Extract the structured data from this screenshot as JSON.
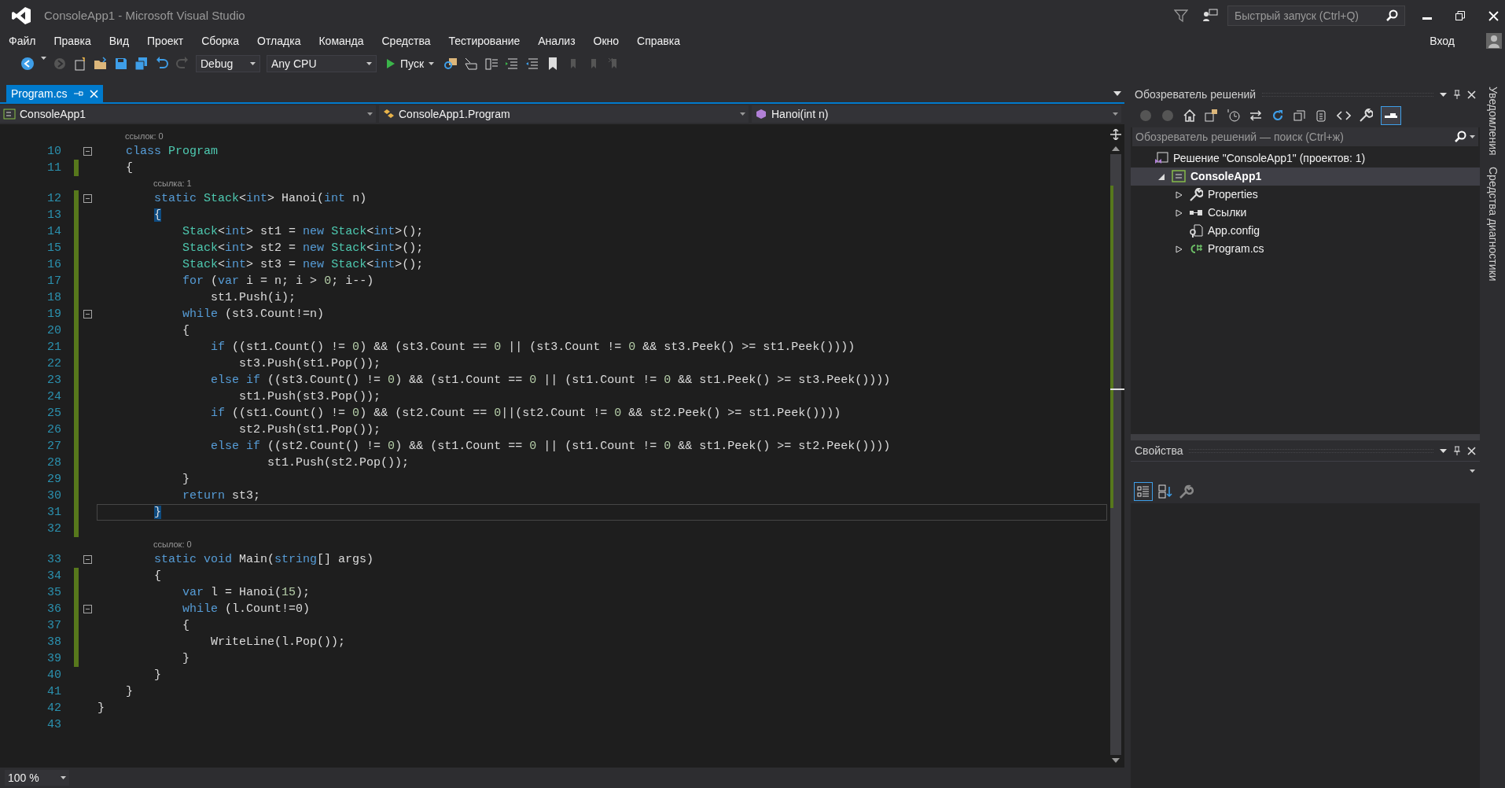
{
  "window": {
    "title": "ConsoleApp1 - Microsoft Visual Studio"
  },
  "quick_launch": {
    "placeholder": "Быстрый запуск (Ctrl+Q)"
  },
  "sign_in": "Вход",
  "menu": [
    "Файл",
    "Правка",
    "Вид",
    "Проект",
    "Сборка",
    "Отладка",
    "Команда",
    "Средства",
    "Тестирование",
    "Анализ",
    "Окно",
    "Справка"
  ],
  "toolbar": {
    "configuration": "Debug",
    "platform": "Any CPU",
    "start": "Пуск"
  },
  "document_tabs": [
    {
      "label": "Program.cs",
      "selected": true
    }
  ],
  "navigation": {
    "project": "ConsoleApp1",
    "type": "ConsoleApp1.Program",
    "member": "Hanoi(int n)"
  },
  "editor": {
    "zoom": "100 %",
    "lines": [
      {
        "number": "10",
        "codelens": "ссылок: 0",
        "changed": false,
        "foldable": true,
        "current": false,
        "tokens": [
          {
            "kind": "keyword",
            "text": "    class"
          },
          {
            "kind": "type",
            "text": " Program"
          }
        ]
      },
      {
        "number": "11",
        "changed": true,
        "foldable": false,
        "current": false,
        "tokens": [
          {
            "kind": "plain",
            "text": "    {"
          }
        ]
      },
      {
        "number": "12",
        "codelens": "ссылка: 1",
        "changed": true,
        "foldable": true,
        "current": false,
        "tokens": [
          {
            "kind": "keyword",
            "text": "        static"
          },
          {
            "kind": "type",
            "text": " Stack"
          },
          {
            "kind": "plain",
            "text": "<"
          },
          {
            "kind": "keyword",
            "text": "int"
          },
          {
            "kind": "plain",
            "text": "> Hanoi("
          },
          {
            "kind": "keyword",
            "text": "int"
          },
          {
            "kind": "plain",
            "text": " n)"
          }
        ]
      },
      {
        "number": "13",
        "changed": true,
        "foldable": false,
        "current": false,
        "tokens": [
          {
            "kind": "brace",
            "text": "        {"
          }
        ]
      },
      {
        "number": "14",
        "changed": true,
        "foldable": false,
        "current": false,
        "tokens": [
          {
            "kind": "type",
            "text": "            Stack"
          },
          {
            "kind": "plain",
            "text": "<"
          },
          {
            "kind": "keyword",
            "text": "int"
          },
          {
            "kind": "plain",
            "text": "> st1 ="
          },
          {
            "kind": "keyword",
            "text": " new"
          },
          {
            "kind": "type",
            "text": " Stack"
          },
          {
            "kind": "plain",
            "text": "<"
          },
          {
            "kind": "keyword",
            "text": "int"
          },
          {
            "kind": "plain",
            "text": ">();"
          }
        ]
      },
      {
        "number": "15",
        "changed": true,
        "foldable": false,
        "current": false,
        "tokens": [
          {
            "kind": "type",
            "text": "            Stack"
          },
          {
            "kind": "plain",
            "text": "<"
          },
          {
            "kind": "keyword",
            "text": "int"
          },
          {
            "kind": "plain",
            "text": "> st2 ="
          },
          {
            "kind": "keyword",
            "text": " new"
          },
          {
            "kind": "type",
            "text": " Stack"
          },
          {
            "kind": "plain",
            "text": "<"
          },
          {
            "kind": "keyword",
            "text": "int"
          },
          {
            "kind": "plain",
            "text": ">();"
          }
        ]
      },
      {
        "number": "16",
        "changed": true,
        "foldable": false,
        "current": false,
        "tokens": [
          {
            "kind": "type",
            "text": "            Stack"
          },
          {
            "kind": "plain",
            "text": "<"
          },
          {
            "kind": "keyword",
            "text": "int"
          },
          {
            "kind": "plain",
            "text": "> st3 ="
          },
          {
            "kind": "keyword",
            "text": " new"
          },
          {
            "kind": "type",
            "text": " Stack"
          },
          {
            "kind": "plain",
            "text": "<"
          },
          {
            "kind": "keyword",
            "text": "int"
          },
          {
            "kind": "plain",
            "text": ">();"
          }
        ]
      },
      {
        "number": "17",
        "changed": true,
        "foldable": false,
        "current": false,
        "tokens": [
          {
            "kind": "keyword",
            "text": "            for"
          },
          {
            "kind": "plain",
            "text": " ("
          },
          {
            "kind": "keyword",
            "text": "var"
          },
          {
            "kind": "plain",
            "text": " i = n; i >"
          },
          {
            "kind": "number",
            "text": " 0"
          },
          {
            "kind": "plain",
            "text": "; i--)"
          }
        ]
      },
      {
        "number": "18",
        "changed": true,
        "foldable": false,
        "current": false,
        "tokens": [
          {
            "kind": "plain",
            "text": "                st1.Push(i);"
          }
        ]
      },
      {
        "number": "19",
        "changed": true,
        "foldable": true,
        "current": false,
        "tokens": [
          {
            "kind": "keyword",
            "text": "            while"
          },
          {
            "kind": "plain",
            "text": " (st3.Count!=n)"
          }
        ]
      },
      {
        "number": "20",
        "changed": true,
        "foldable": false,
        "current": false,
        "tokens": [
          {
            "kind": "plain",
            "text": "            {"
          }
        ]
      },
      {
        "number": "21",
        "changed": true,
        "foldable": false,
        "current": false,
        "tokens": [
          {
            "kind": "keyword",
            "text": "                if"
          },
          {
            "kind": "plain",
            "text": " ((st1.Count() !="
          },
          {
            "kind": "number",
            "text": " 0"
          },
          {
            "kind": "plain",
            "text": ") && (st3.Count =="
          },
          {
            "kind": "number",
            "text": " 0"
          },
          {
            "kind": "plain",
            "text": " || (st3.Count !="
          },
          {
            "kind": "number",
            "text": " 0"
          },
          {
            "kind": "plain",
            "text": " && st3.Peek() >= st1.Peek())))"
          }
        ]
      },
      {
        "number": "22",
        "changed": true,
        "foldable": false,
        "current": false,
        "tokens": [
          {
            "kind": "plain",
            "text": "                    st3.Push(st1.Pop());"
          }
        ]
      },
      {
        "number": "23",
        "changed": true,
        "foldable": false,
        "current": false,
        "tokens": [
          {
            "kind": "keyword",
            "text": "                else if"
          },
          {
            "kind": "plain",
            "text": " ((st3.Count() !="
          },
          {
            "kind": "number",
            "text": " 0"
          },
          {
            "kind": "plain",
            "text": ") && (st1.Count =="
          },
          {
            "kind": "number",
            "text": " 0"
          },
          {
            "kind": "plain",
            "text": " || (st1.Count !="
          },
          {
            "kind": "number",
            "text": " 0"
          },
          {
            "kind": "plain",
            "text": " && st1.Peek() >= st3.Peek())))"
          }
        ]
      },
      {
        "number": "24",
        "changed": true,
        "foldable": false,
        "current": false,
        "tokens": [
          {
            "kind": "plain",
            "text": "                    st1.Push(st3.Pop());"
          }
        ]
      },
      {
        "number": "25",
        "changed": true,
        "foldable": false,
        "current": false,
        "tokens": [
          {
            "kind": "keyword",
            "text": "                if"
          },
          {
            "kind": "plain",
            "text": " ((st1.Count() !="
          },
          {
            "kind": "number",
            "text": " 0"
          },
          {
            "kind": "plain",
            "text": ") && (st2.Count =="
          },
          {
            "kind": "number",
            "text": " 0"
          },
          {
            "kind": "plain",
            "text": "||(st2.Count !="
          },
          {
            "kind": "number",
            "text": " 0"
          },
          {
            "kind": "plain",
            "text": " && st2.Peek() >= st1.Peek())))"
          }
        ]
      },
      {
        "number": "26",
        "changed": true,
        "foldable": false,
        "current": false,
        "tokens": [
          {
            "kind": "plain",
            "text": "                    st2.Push(st1.Pop());"
          }
        ]
      },
      {
        "number": "27",
        "changed": true,
        "foldable": false,
        "current": false,
        "tokens": [
          {
            "kind": "keyword",
            "text": "                else if"
          },
          {
            "kind": "plain",
            "text": " ((st2.Count() !="
          },
          {
            "kind": "number",
            "text": " 0"
          },
          {
            "kind": "plain",
            "text": ") && (st1.Count =="
          },
          {
            "kind": "number",
            "text": " 0"
          },
          {
            "kind": "plain",
            "text": " || (st1.Count !="
          },
          {
            "kind": "number",
            "text": " 0"
          },
          {
            "kind": "plain",
            "text": " && st1.Peek() >= st2.Peek())))"
          }
        ]
      },
      {
        "number": "28",
        "changed": true,
        "foldable": false,
        "current": false,
        "tokens": [
          {
            "kind": "plain",
            "text": "                        st1.Push(st2.Pop());"
          }
        ]
      },
      {
        "number": "29",
        "changed": true,
        "foldable": false,
        "current": false,
        "tokens": [
          {
            "kind": "plain",
            "text": "            }"
          }
        ]
      },
      {
        "number": "30",
        "changed": true,
        "foldable": false,
        "current": false,
        "tokens": [
          {
            "kind": "keyword",
            "text": "            return"
          },
          {
            "kind": "plain",
            "text": " st3;"
          }
        ]
      },
      {
        "number": "31",
        "changed": true,
        "foldable": false,
        "current": true,
        "tokens": [
          {
            "kind": "brace",
            "text": "        }"
          }
        ]
      },
      {
        "number": "32",
        "changed": true,
        "foldable": false,
        "current": false
      },
      {
        "number": "33",
        "codelens": "ссылок: 0",
        "changed": false,
        "foldable": true,
        "current": false,
        "tokens": [
          {
            "kind": "keyword",
            "text": "        static void"
          },
          {
            "kind": "plain",
            "text": " Main("
          },
          {
            "kind": "keyword",
            "text": "string"
          },
          {
            "kind": "plain",
            "text": "[] args)"
          }
        ]
      },
      {
        "number": "34",
        "changed": true,
        "foldable": false,
        "current": false,
        "tokens": [
          {
            "kind": "plain",
            "text": "        {"
          }
        ]
      },
      {
        "number": "35",
        "changed": true,
        "foldable": false,
        "current": false,
        "tokens": [
          {
            "kind": "keyword",
            "text": "            var"
          },
          {
            "kind": "plain",
            "text": " l = Hanoi("
          },
          {
            "kind": "number",
            "text": "15"
          },
          {
            "kind": "plain",
            "text": ");"
          }
        ]
      },
      {
        "number": "36",
        "changed": true,
        "foldable": true,
        "current": false,
        "tokens": [
          {
            "kind": "keyword",
            "text": "            while"
          },
          {
            "kind": "plain",
            "text": " (l.Count!=0)"
          }
        ]
      },
      {
        "number": "37",
        "changed": true,
        "foldable": false,
        "current": false,
        "tokens": [
          {
            "kind": "plain",
            "text": "            {"
          }
        ]
      },
      {
        "number": "38",
        "changed": true,
        "foldable": false,
        "current": false,
        "tokens": [
          {
            "kind": "plain",
            "text": "                WriteLine(l.Pop());"
          }
        ]
      },
      {
        "number": "39",
        "changed": true,
        "foldable": false,
        "current": false,
        "tokens": [
          {
            "kind": "plain",
            "text": "            }"
          }
        ]
      },
      {
        "number": "40",
        "changed": false,
        "foldable": false,
        "current": false,
        "tokens": [
          {
            "kind": "plain",
            "text": "        }"
          }
        ]
      },
      {
        "number": "41",
        "changed": false,
        "foldable": false,
        "current": false,
        "tokens": [
          {
            "kind": "plain",
            "text": "    }"
          }
        ]
      },
      {
        "number": "42",
        "changed": false,
        "foldable": false,
        "current": false,
        "tokens": [
          {
            "kind": "plain",
            "text": "}"
          }
        ]
      },
      {
        "number": "43",
        "changed": false,
        "foldable": false,
        "current": false
      }
    ]
  },
  "solution_explorer": {
    "title": "Обозреватель решений",
    "search": {
      "placeholder": "Обозреватель решений — поиск (Ctrl+ж)"
    },
    "tree": [
      {
        "kind": "solution",
        "label": "Решение \"ConsoleApp1\"  (проектов: 1)",
        "selected": false,
        "children": [
          {
            "kind": "project",
            "label": "ConsoleApp1",
            "selected": true,
            "expanded": true,
            "children": [
              {
                "kind": "properties",
                "label": "Properties",
                "selected": false,
                "expanded": false
              },
              {
                "kind": "references",
                "label": "Ссылки",
                "selected": false,
                "expanded": false
              },
              {
                "kind": "config",
                "label": "App.config",
                "selected": false
              },
              {
                "kind": "csharp",
                "label": "Program.cs",
                "selected": false,
                "expanded": false
              }
            ]
          }
        ]
      }
    ]
  },
  "properties": {
    "title": "Свойства"
  },
  "side_tabs": [
    "Уведомления",
    "Средства диагностики"
  ]
}
